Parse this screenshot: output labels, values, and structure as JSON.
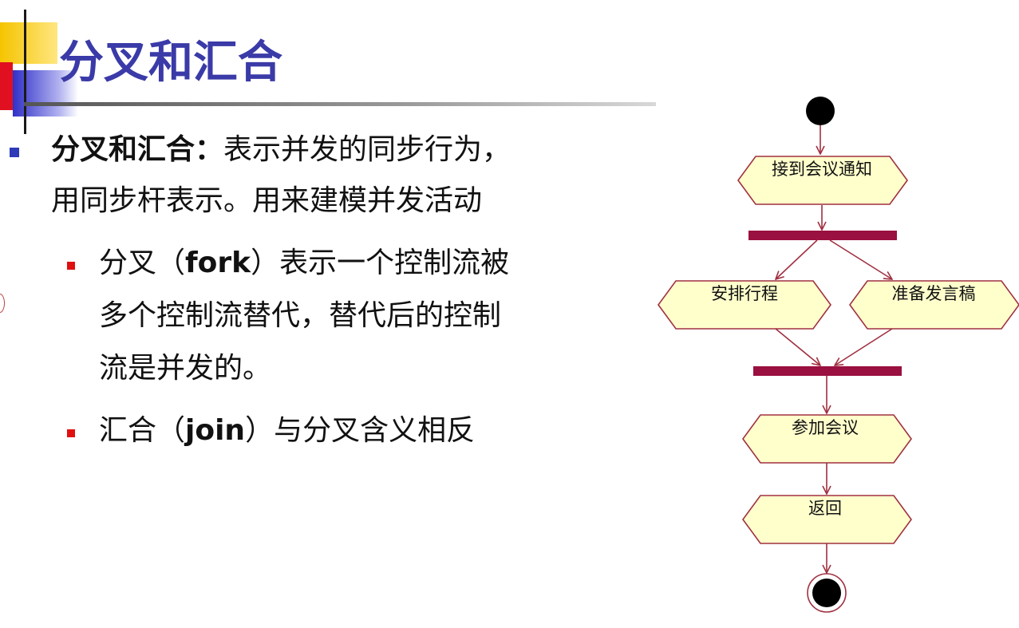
{
  "slide": {
    "title": "分叉和汇合",
    "points": [
      {
        "term": "分叉和汇合：",
        "line1_rest": "表示并发的同步行为，",
        "line2": "用同步杆表示。用来建模并发活动"
      }
    ],
    "sub_points": [
      {
        "pre": "分叉（",
        "keyword": "fork",
        "line1_rest": "）表示一个控制流被",
        "line2": "多个控制流替代，替代后的控制",
        "line3": "流是并发的。"
      },
      {
        "pre": "汇合（",
        "keyword": "join",
        "line1_rest": "）与分叉含义相反"
      }
    ]
  },
  "diagram": {
    "activities": [
      "接到会议通知",
      "安排行程",
      "准备发言稿",
      "参加会议",
      "返回"
    ],
    "colors": {
      "activity_fill": "#ffffcc",
      "activity_stroke": "#a03040",
      "sync_bar": "#9a1040",
      "arrow": "#a03040",
      "node": "#000000"
    }
  }
}
